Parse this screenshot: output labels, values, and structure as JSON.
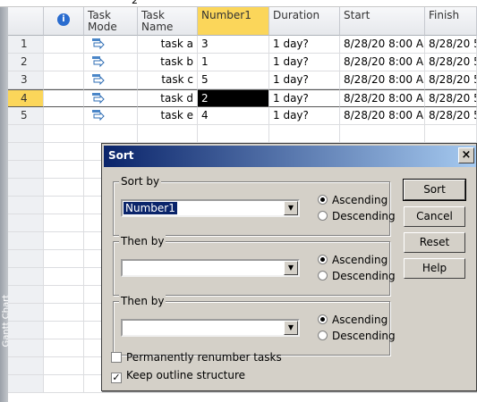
{
  "entry_bar": {
    "value": "2"
  },
  "view_bar": {
    "label": "Gantt Chart"
  },
  "columns": {
    "info": "ⓘ",
    "task_mode": "Task Mode",
    "task_name": "Task Name",
    "number1": "Number1",
    "duration": "Duration",
    "start": "Start",
    "finish": "Finish"
  },
  "rows": [
    {
      "id": "1",
      "name": "task a",
      "number1": "3",
      "duration": "1 day?",
      "start": "8/28/20 8:00 AI",
      "finish": "8/28/20 5"
    },
    {
      "id": "2",
      "name": "task b",
      "number1": "1",
      "duration": "1 day?",
      "start": "8/28/20 8:00 AI",
      "finish": "8/28/20 5"
    },
    {
      "id": "3",
      "name": "task c",
      "number1": "5",
      "duration": "1 day?",
      "start": "8/28/20 8:00 AI",
      "finish": "8/28/20 5"
    },
    {
      "id": "4",
      "name": "task d",
      "number1": "2",
      "duration": "1 day?",
      "start": "8/28/20 8:00 AI",
      "finish": "8/28/20 5"
    },
    {
      "id": "5",
      "name": "task e",
      "number1": "4",
      "duration": "1 day?",
      "start": "8/28/20 8:00 AI",
      "finish": "8/28/20 5"
    }
  ],
  "dialog": {
    "title": "Sort",
    "close": "×",
    "sort_by": {
      "legend": "Sort by",
      "value": "Number1",
      "asc": "Ascending",
      "desc": "Descending",
      "selected": "ascending"
    },
    "then_by_1": {
      "legend": "Then by",
      "value": "",
      "asc": "Ascending",
      "desc": "Descending",
      "selected": "ascending"
    },
    "then_by_2": {
      "legend": "Then by",
      "value": "",
      "asc": "Ascending",
      "desc": "Descending",
      "selected": "ascending"
    },
    "buttons": {
      "sort": "Sort",
      "cancel": "Cancel",
      "reset": "Reset",
      "help": "Help"
    },
    "renumber": {
      "label": "Permanently renumber tasks",
      "checked": false
    },
    "keep_outline": {
      "label": "Keep outline structure",
      "checked": true
    }
  },
  "colors": {
    "selection_yellow": "#fbd65a",
    "title_bar_start": "#0a246a",
    "title_bar_end": "#a6caf0",
    "dialog_face": "#d4d0c8"
  }
}
